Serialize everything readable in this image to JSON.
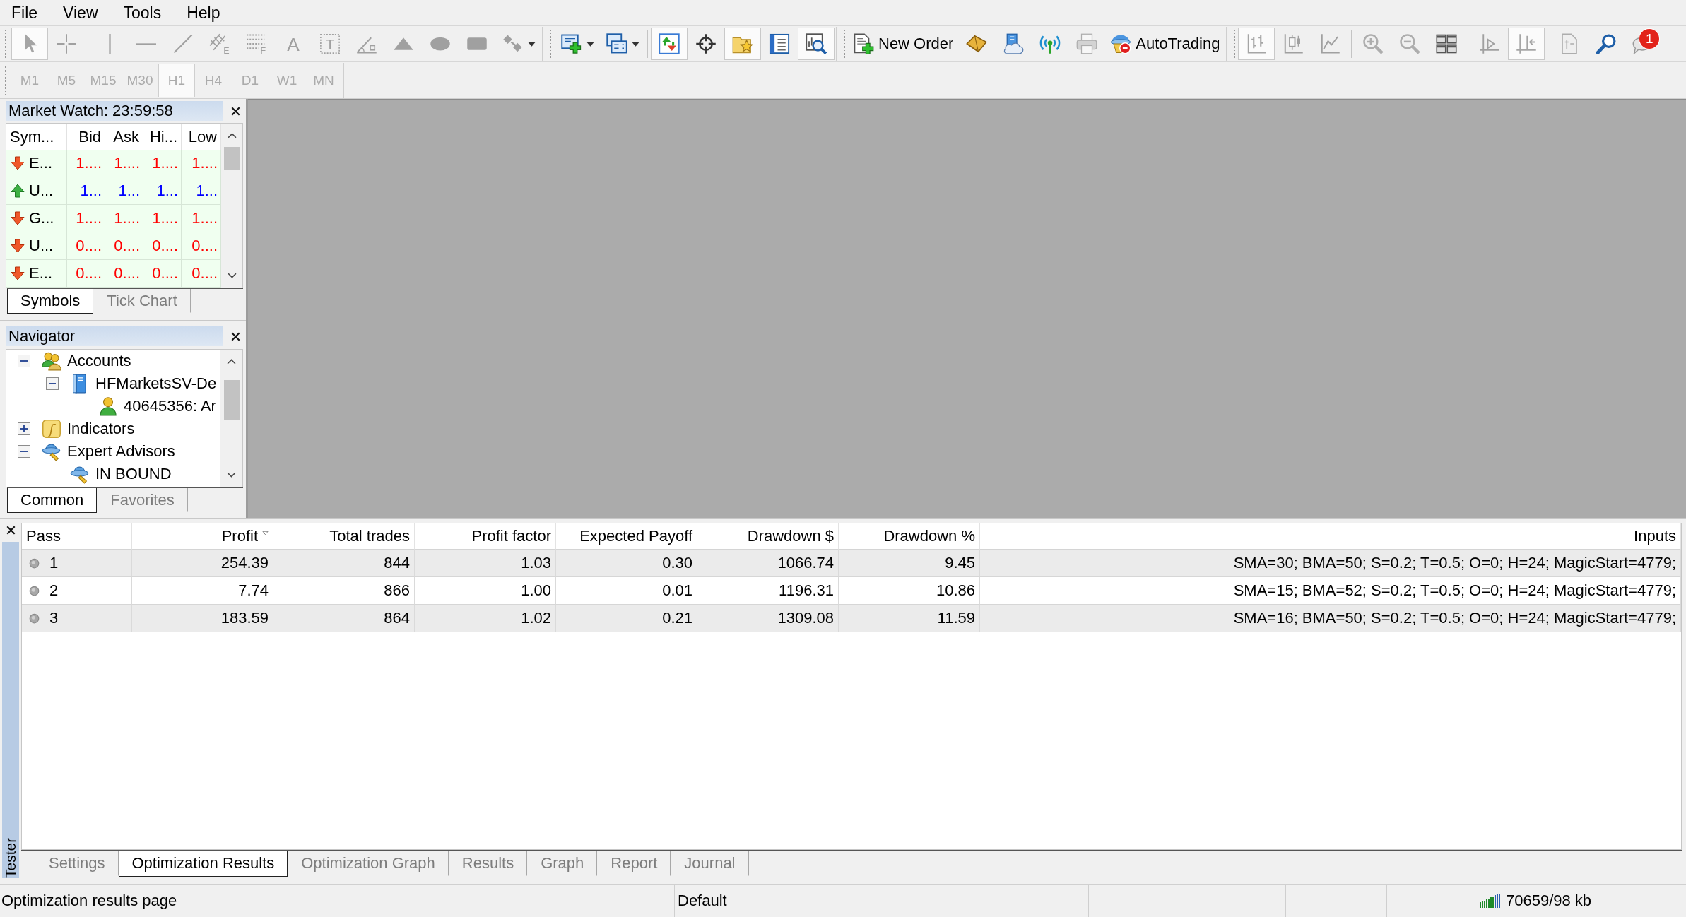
{
  "menu": [
    "File",
    "View",
    "Tools",
    "Help"
  ],
  "toolbars": [
    {
      "groups": [
        {
          "buttons": [
            {
              "pressed": true,
              "disabled": true,
              "dropdown": false
            },
            {
              "pressed": false,
              "disabled": true,
              "dropdown": false
            }
          ]
        },
        {
          "buttons": [
            {
              "pressed": false,
              "disabled": true,
              "dropdown": false
            },
            {
              "pressed": false,
              "disabled": true,
              "dropdown": false
            },
            {
              "pressed": false,
              "disabled": true,
              "dropdown": false
            },
            {
              "glyph": "E",
              "pressed": false,
              "disabled": true,
              "dropdown": false
            },
            {
              "glyph": "F",
              "pressed": false,
              "disabled": true,
              "dropdown": false
            },
            {
              "glyph": "A",
              "pressed": false,
              "disabled": true,
              "dropdown": false
            },
            {
              "glyph": "T",
              "pressed": false,
              "disabled": true,
              "dropdown": false
            },
            {
              "pressed": false,
              "disabled": true,
              "dropdown": false
            },
            {
              "pressed": false,
              "disabled": true,
              "dropdown": false
            },
            {
              "pressed": false,
              "disabled": true,
              "dropdown": false
            },
            {
              "pressed": false,
              "disabled": true,
              "dropdown": false
            },
            {
              "pressed": false,
              "disabled": true,
              "dropdown": true
            }
          ]
        }
      ]
    },
    {
      "groups": [
        {
          "buttons": [
            {
              "pressed": false,
              "disabled": false,
              "dropdown": true
            },
            {
              "pressed": false,
              "disabled": false,
              "dropdown": true
            }
          ]
        },
        {
          "buttons": [
            {
              "pressed": true,
              "disabled": false,
              "dropdown": false
            },
            {
              "pressed": false,
              "disabled": false,
              "dropdown": false
            },
            {
              "pressed": true,
              "disabled": false,
              "dropdown": false
            },
            {
              "pressed": false,
              "disabled": false,
              "dropdown": false
            },
            {
              "pressed": true,
              "disabled": false,
              "dropdown": false
            }
          ]
        }
      ]
    },
    {
      "groups": [
        {
          "buttons": [
            {
              "label": "New Order",
              "pressed": false,
              "disabled": false,
              "dropdown": false
            },
            {
              "pressed": false,
              "disabled": false,
              "dropdown": false
            },
            {
              "pressed": false,
              "disabled": false,
              "dropdown": false
            },
            {
              "pressed": false,
              "disabled": false,
              "dropdown": false
            },
            {
              "pressed": false,
              "disabled": true,
              "dropdown": false
            },
            {
              "label": "AutoTrading",
              "pressed": false,
              "disabled": false,
              "dropdown": false
            }
          ]
        }
      ]
    },
    {
      "groups": [
        {
          "buttons": [
            {
              "pressed": true,
              "disabled": true,
              "dropdown": false
            },
            {
              "pressed": false,
              "disabled": true,
              "dropdown": false
            },
            {
              "pressed": false,
              "disabled": true,
              "dropdown": false
            }
          ]
        },
        {
          "buttons": [
            {
              "pressed": false,
              "disabled": true,
              "dropdown": false
            },
            {
              "pressed": false,
              "disabled": true,
              "dropdown": false
            },
            {
              "pressed": false,
              "disabled": false,
              "dropdown": false
            }
          ]
        },
        {
          "buttons": [
            {
              "pressed": false,
              "disabled": true,
              "dropdown": false
            },
            {
              "pressed": true,
              "disabled": true,
              "dropdown": false
            }
          ]
        },
        {
          "buttons": [
            {
              "pressed": false,
              "disabled": true,
              "dropdown": false
            },
            {
              "pressed": false,
              "disabled": false,
              "dropdown": false
            },
            {
              "badge": "1",
              "pressed": false,
              "disabled": false,
              "dropdown": false
            }
          ]
        }
      ]
    }
  ],
  "timeframes": {
    "disabled": true,
    "items": [
      {
        "label": "M1",
        "selected": false
      },
      {
        "label": "M5",
        "selected": false
      },
      {
        "label": "M15",
        "selected": false
      },
      {
        "label": "M30",
        "selected": false
      },
      {
        "label": "H1",
        "selected": true
      },
      {
        "label": "H4",
        "selected": false
      },
      {
        "label": "D1",
        "selected": false
      },
      {
        "label": "W1",
        "selected": false
      },
      {
        "label": "MN",
        "selected": false
      }
    ]
  },
  "market_watch": {
    "title": "Market Watch: 23:59:58",
    "columns": [
      "Sym...",
      "Bid",
      "Ask",
      "Hi...",
      "Low"
    ],
    "rows": [
      {
        "rising": false,
        "symbol": "E...",
        "bid": "1....",
        "ask": "1....",
        "high": "1....",
        "low": "1...."
      },
      {
        "rising": true,
        "symbol": "U...",
        "bid": "1...",
        "ask": "1...",
        "high": "1...",
        "low": "1..."
      },
      {
        "rising": false,
        "symbol": "G...",
        "bid": "1....",
        "ask": "1....",
        "high": "1....",
        "low": "1...."
      },
      {
        "rising": false,
        "symbol": "U...",
        "bid": "0....",
        "ask": "0....",
        "high": "0....",
        "low": "0...."
      },
      {
        "rising": false,
        "symbol": "E...",
        "bid": "0....",
        "ask": "0....",
        "high": "0....",
        "low": "0...."
      }
    ],
    "tabs": [
      {
        "label": "Symbols",
        "selected": true
      },
      {
        "label": "Tick Chart",
        "selected": false
      }
    ]
  },
  "navigator": {
    "title": "Navigator",
    "tree": [
      {
        "kind": "accounts",
        "label": "Accounts",
        "expanded": true,
        "children": [
          {
            "kind": "server",
            "label": "HFMarketsSV-De",
            "expanded": true,
            "children": [
              {
                "kind": "account",
                "label": "40645356: Ar"
              }
            ]
          }
        ]
      },
      {
        "kind": "indicators",
        "label": "Indicators",
        "glyph": "f",
        "expanded": false
      },
      {
        "kind": "experts",
        "label": "Expert Advisors",
        "expanded": true,
        "children": [
          {
            "kind": "expert",
            "label": "IN BOUND"
          }
        ]
      }
    ],
    "tabs": [
      {
        "label": "Common",
        "selected": true
      },
      {
        "label": "Favorites",
        "selected": false
      }
    ]
  },
  "tester": {
    "title": "Tester",
    "table": {
      "columns": [
        {
          "label": "Pass",
          "sorted": false
        },
        {
          "label": "Profit",
          "sorted": true
        },
        {
          "label": "Total trades",
          "sorted": false
        },
        {
          "label": "Profit factor",
          "sorted": false
        },
        {
          "label": "Expected Payoff",
          "sorted": false
        },
        {
          "label": "Drawdown $",
          "sorted": false
        },
        {
          "label": "Drawdown %",
          "sorted": false
        },
        {
          "label": "Inputs",
          "sorted": false
        }
      ],
      "rows": [
        {
          "cells": [
            "1",
            "254.39",
            "844",
            "1.03",
            "0.30",
            "1066.74",
            "9.45",
            "SMA=30; BMA=50; S=0.2; T=0.5; O=0; H=24; MagicStart=4779;"
          ]
        },
        {
          "cells": [
            "2",
            "7.74",
            "866",
            "1.00",
            "0.01",
            "1196.31",
            "10.86",
            "SMA=15; BMA=52; S=0.2; T=0.5; O=0; H=24; MagicStart=4779;"
          ]
        },
        {
          "cells": [
            "3",
            "183.59",
            "864",
            "1.02",
            "0.21",
            "1309.08",
            "11.59",
            "SMA=16; BMA=50; S=0.2; T=0.5; O=0; H=24; MagicStart=4779;"
          ]
        }
      ]
    },
    "tabs": [
      {
        "label": "Settings",
        "selected": false
      },
      {
        "label": "Optimization Results",
        "selected": true
      },
      {
        "label": "Optimization Graph",
        "selected": false
      },
      {
        "label": "Results",
        "selected": false
      },
      {
        "label": "Graph",
        "selected": false
      },
      {
        "label": "Report",
        "selected": false
      },
      {
        "label": "Journal",
        "selected": false
      }
    ]
  },
  "status_bar": {
    "message": "Optimization results page",
    "profile": "Default",
    "traffic": "70659/98 kb"
  }
}
